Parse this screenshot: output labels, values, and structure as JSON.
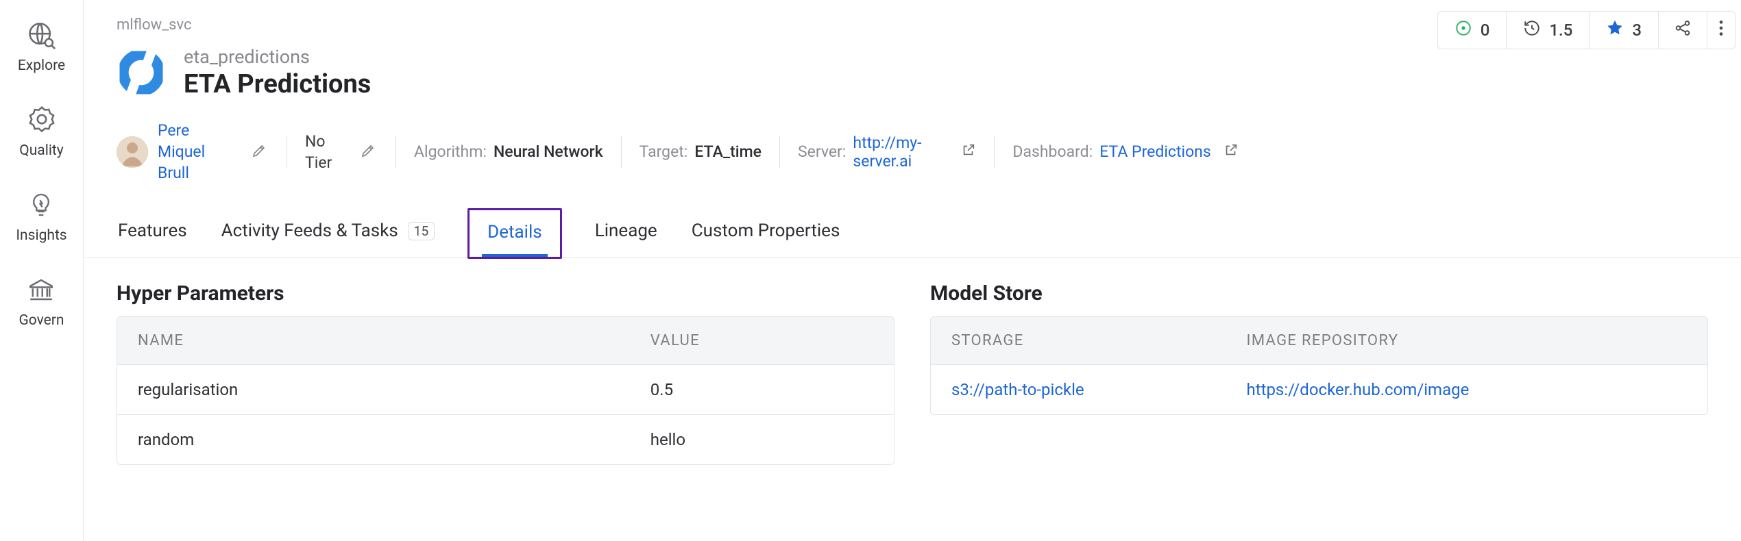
{
  "sidebar": {
    "items": [
      {
        "label": "Explore"
      },
      {
        "label": "Quality"
      },
      {
        "label": "Insights"
      },
      {
        "label": "Govern"
      }
    ]
  },
  "breadcrumb": "mlflow_svc",
  "entity": {
    "slug": "eta_predictions",
    "title": "ETA Predictions"
  },
  "stats": {
    "issues": "0",
    "recent": "1.5",
    "stars": "3"
  },
  "meta": {
    "owner": "Pere Miquel Brull",
    "tier": "No Tier",
    "algorithm_label": "Algorithm:",
    "algorithm_value": "Neural Network",
    "target_label": "Target:",
    "target_value": "ETA_time",
    "server_label": "Server:",
    "server_value": "http://my-server.ai",
    "dashboard_label": "Dashboard:",
    "dashboard_value": "ETA Predictions"
  },
  "tabs": [
    {
      "label": "Features"
    },
    {
      "label": "Activity Feeds & Tasks",
      "badge": "15"
    },
    {
      "label": "Details",
      "active": true
    },
    {
      "label": "Lineage"
    },
    {
      "label": "Custom Properties"
    }
  ],
  "hyper": {
    "title": "Hyper Parameters",
    "headers": {
      "name": "NAME",
      "value": "VALUE"
    },
    "rows": [
      {
        "name": "regularisation",
        "value": "0.5"
      },
      {
        "name": "random",
        "value": "hello"
      }
    ]
  },
  "store": {
    "title": "Model Store",
    "headers": {
      "storage": "STORAGE",
      "repo": "IMAGE REPOSITORY"
    },
    "storage": "s3://path-to-pickle",
    "repo": "https://docker.hub.com/image"
  }
}
